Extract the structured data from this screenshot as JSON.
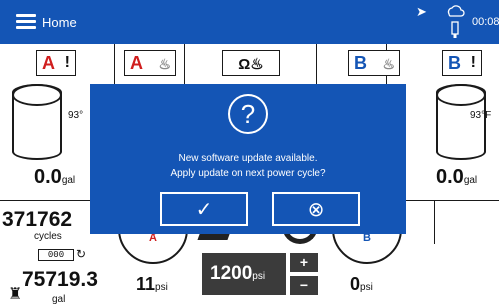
{
  "header": {
    "title": "Home",
    "clock": "00:08",
    "menu_icon": "hamburger-menu-icon",
    "status_icons": [
      "navigation-arrow-icon",
      "cloud-usb-icon"
    ],
    "bar_color": "#1455b5"
  },
  "tanks": {
    "left": {
      "badge_letter": "A",
      "badge_mark": "!",
      "temperature": "93°",
      "volume": "0.0",
      "volume_unit": "gal"
    },
    "right": {
      "badge_letter": "B",
      "badge_mark": "!",
      "temperature": "93°F",
      "volume": "0.0",
      "volume_unit": "gal"
    }
  },
  "heaters": {
    "a_letter": "A",
    "b_letter": "B",
    "center_icon": "heater-icon"
  },
  "counters": {
    "cycles_value": "371762",
    "cycles_label": "cycles",
    "counter_box": "000",
    "gallons_value": "75719.3",
    "gallons_label": "gal"
  },
  "gauges": {
    "a_label": "A",
    "b_label": "B",
    "a_pressure": "11",
    "b_pressure": "0",
    "unit": "psi"
  },
  "setpoint": {
    "value": "1200",
    "unit": "psi",
    "plus": "+",
    "minus": "−"
  },
  "dialog": {
    "icon": "?",
    "line1": "New software update available.",
    "line2": "Apply update on next power cycle?",
    "confirm_label": "✓",
    "cancel_label": "⊗"
  },
  "colors": {
    "accent_blue": "#1455b5",
    "alert_red": "#d01e1e",
    "setpoint_dark": "#3b3b3b"
  }
}
